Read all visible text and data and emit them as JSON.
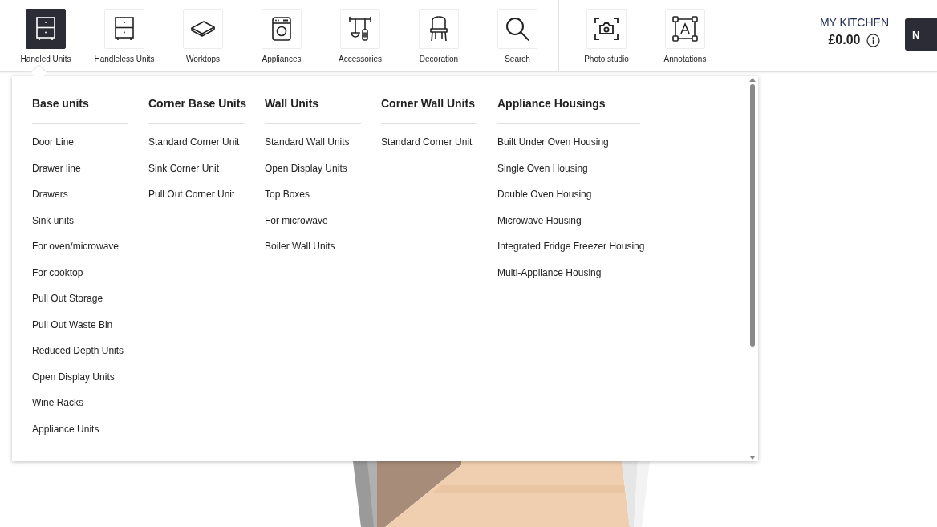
{
  "toolbar": {
    "tools": [
      {
        "kind": "cabinet",
        "label": "Handled Units",
        "selected": true
      },
      {
        "kind": "cabinet",
        "label": "Handleless Units",
        "selected": false
      },
      {
        "kind": "worktop",
        "label": "Worktops",
        "selected": false
      },
      {
        "kind": "washer",
        "label": "Appliances",
        "selected": false
      },
      {
        "kind": "utensils",
        "label": "Accessories",
        "selected": false
      },
      {
        "kind": "chair",
        "label": "Decoration",
        "selected": false
      },
      {
        "kind": "search",
        "label": "Search",
        "selected": false
      }
    ],
    "extras": [
      {
        "kind": "camera",
        "label": "Photo studio",
        "selected": false
      },
      {
        "kind": "annotate",
        "label": "Annotations",
        "selected": false
      }
    ]
  },
  "project": {
    "title": "MY KITCHEN",
    "price": "£0.00",
    "button": "N"
  },
  "menu": {
    "columns": [
      {
        "heading": "Base units",
        "items": [
          "Door Line",
          "Drawer line",
          "Drawers",
          "Sink units",
          "For oven/microwave",
          "For cooktop",
          "Pull Out Storage",
          "Pull Out Waste Bin",
          "Reduced Depth Units",
          "Open Display Units",
          "Wine Racks",
          "Appliance Units"
        ]
      },
      {
        "heading": "Corner Base Units",
        "items": [
          "Standard Corner Unit",
          "Sink Corner Unit",
          "Pull Out Corner Unit"
        ]
      },
      {
        "heading": "Wall Units",
        "items": [
          "Standard Wall Units",
          "Open Display Units",
          "Top Boxes",
          "For microwave",
          "Boiler Wall Units"
        ]
      },
      {
        "heading": "Corner Wall Units",
        "items": [
          "Standard Corner Unit"
        ]
      },
      {
        "heading": "Appliance Housings",
        "items": [
          "Built Under Oven Housing",
          "Single Oven Housing",
          "Double Oven Housing",
          "Microwave Housing",
          "Integrated Fridge Freezer Housing",
          "Multi-Appliance Housing"
        ]
      }
    ]
  }
}
